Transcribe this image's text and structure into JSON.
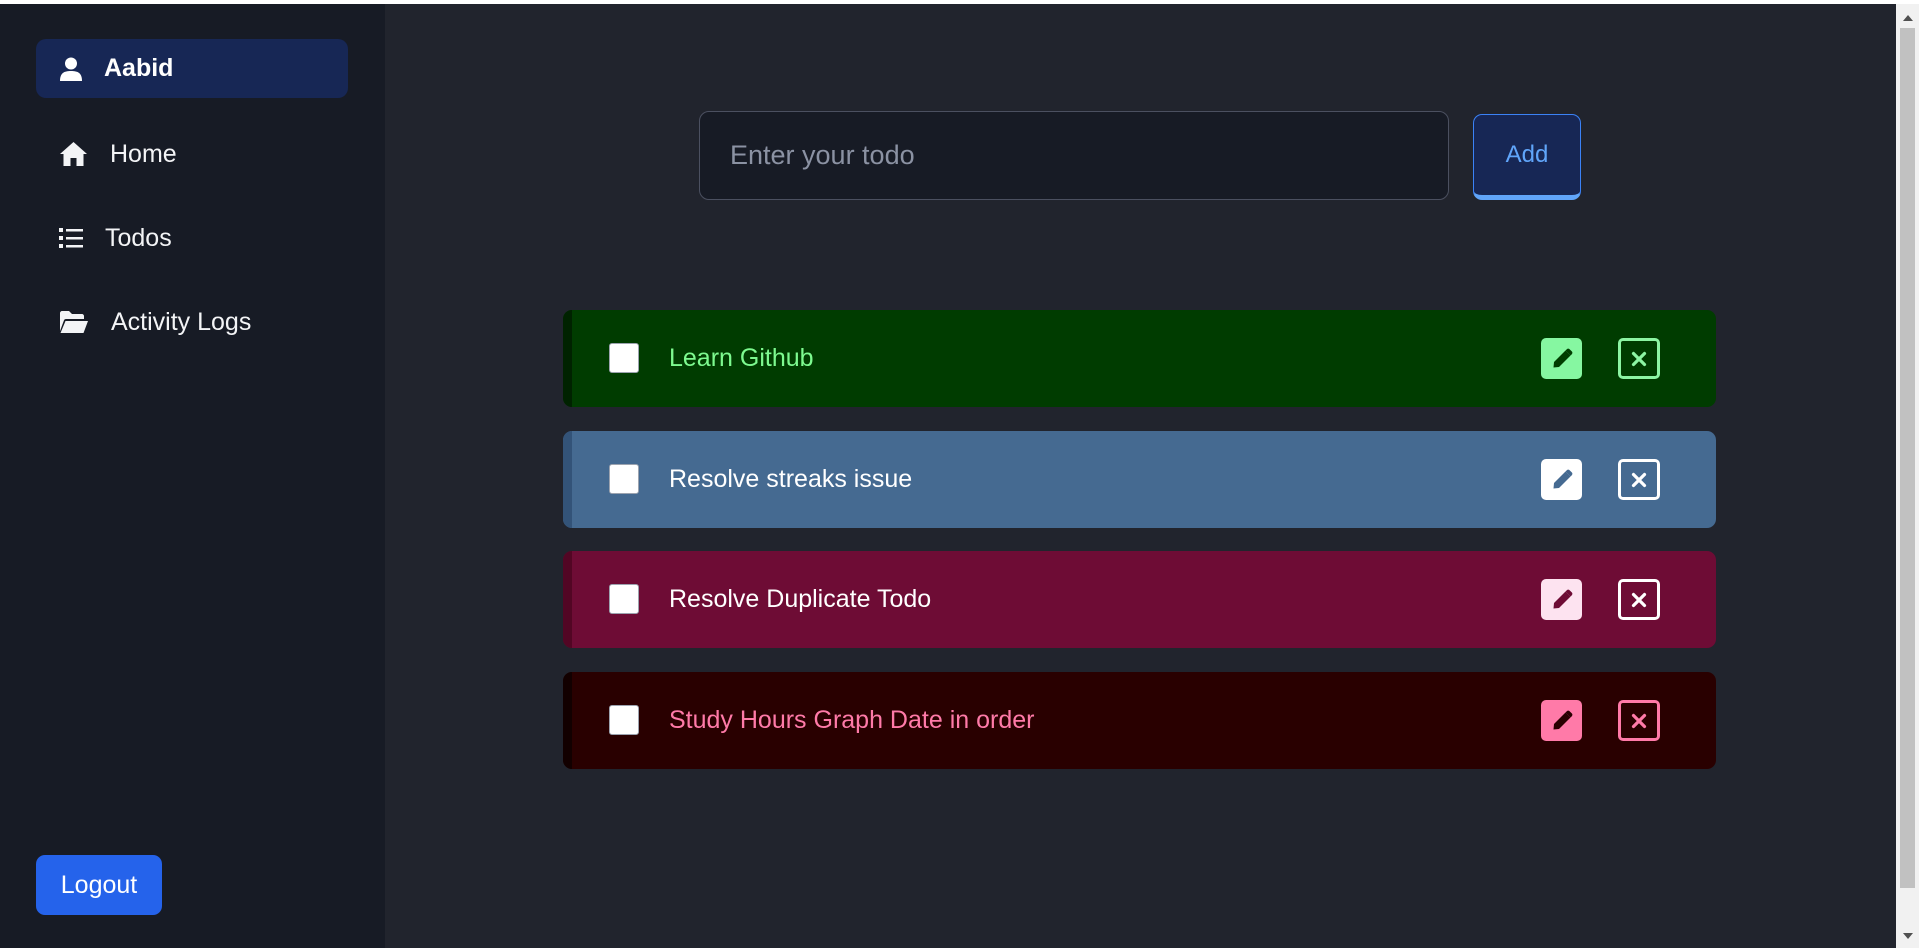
{
  "sidebar": {
    "user": {
      "name": "Aabid",
      "icon": "user-icon"
    },
    "items": [
      {
        "label": "Home",
        "icon": "home-icon"
      },
      {
        "label": "Todos",
        "icon": "list-icon"
      },
      {
        "label": "Activity Logs",
        "icon": "folder-open-icon"
      }
    ],
    "logout_label": "Logout"
  },
  "main": {
    "input": {
      "placeholder": "Enter your todo",
      "value": ""
    },
    "add_label": "Add",
    "todos": [
      {
        "text": "Learn Github",
        "checked": false,
        "bg": "#003c00",
        "accent": "#002200",
        "text_color": "#7dfa8f",
        "edit_bg": "#86f7a1",
        "icon_color": "#8cf5a3",
        "pen_color": "#013d00"
      },
      {
        "text": "Resolve streaks issue",
        "checked": false,
        "bg": "#456a91",
        "accent": "#335378",
        "text_color": "#ffffff",
        "edit_bg": "#ffffff",
        "icon_color": "#ffffff",
        "pen_color": "#456a91"
      },
      {
        "text": "Resolve Duplicate Todo",
        "checked": false,
        "bg": "#6e0c35",
        "accent": "#520624",
        "text_color": "#ffffff",
        "edit_bg": "#fde3f0",
        "icon_color": "#ffffff",
        "pen_color": "#6e0c35"
      },
      {
        "text": "Study Hours Graph Date in order",
        "checked": false,
        "bg": "#290000",
        "accent": "#120000",
        "text_color": "#ff7aa8",
        "edit_bg": "#ff7aa8",
        "icon_color": "#ff7aa8",
        "pen_color": "#290000"
      }
    ]
  },
  "colors": {
    "page_bg": "#21242d",
    "sidebar_bg": "#171b25",
    "user_pill_bg": "#172755",
    "primary": "#2563eb",
    "add_text": "#60a5fa"
  }
}
